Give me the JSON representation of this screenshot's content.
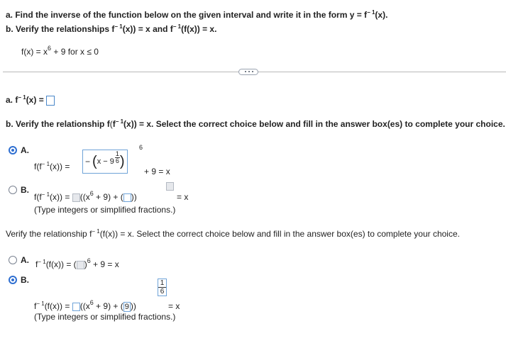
{
  "question": {
    "part_a": "a. Find the inverse of the function below on the given interval and write it in the form y = f",
    "part_a_tail": "(x).",
    "part_b": "b. Verify the relationships f",
    "part_b_mid": "(x)) = x and f",
    "part_b_tail": "(f(x)) = x.",
    "function_lhs": "f(x) = x",
    "function_rhs": " + 9 for x ≤ 0",
    "exp6": "6",
    "inv_sup": "− 1"
  },
  "answer_a": {
    "label": "a. f",
    "label_tail": "(x) ="
  },
  "part_b_section": {
    "prompt_lead": "b. Verify the relationship f",
    "prompt_mid": "(x)) = x. Select the correct choice below and fill in the answer box(es) to complete your choice.",
    "option_a_label": "A.",
    "option_a_lhs": "f(f",
    "option_a_lhs_tail": "(x)) =",
    "option_a_minus": "−",
    "option_a_inner": "x − 9",
    "option_a_frac_num": "1",
    "option_a_frac_den": "6",
    "option_a_outer_exp": "6",
    "option_a_tail": "+ 9 = x",
    "option_b_label": "B.",
    "option_b_lhs": "f(f",
    "option_b_lhs_tail": "(x)) =",
    "option_b_mid": "((x",
    "option_b_mid2": " + 9) + (",
    "option_b_close": "))",
    "option_b_eq": "= x",
    "hint": "(Type integers or simplified fractions.)"
  },
  "part_c_section": {
    "prompt_lead": "Verify the relationship f",
    "prompt_tail": "(f(x)) = x. Select the correct choice below and fill in the answer box(es) to complete your choice.",
    "option_a_label": "A.",
    "option_a_lhs": "f",
    "option_a_lhs_tail": "(f(x)) = (",
    "option_a_close": ")",
    "option_a_exp": "6",
    "option_a_tail": "+ 9 = x",
    "option_b_label": "B.",
    "option_b_lhs": "f",
    "option_b_lhs_tail": "(f(x)) =",
    "option_b_mid": "((x",
    "option_b_mid2": " + 9) + (",
    "option_b_value": "9",
    "option_b_close": "))",
    "option_b_frac_num": "1",
    "option_b_frac_den": "6",
    "option_b_eq": "= x",
    "hint": "(Type integers or simplified fractions.)"
  },
  "selection": {
    "part_b": "A",
    "part_c": "B"
  },
  "colors": {
    "accent": "#2f6fd1",
    "box_border": "#6fa3d8",
    "divider": "#b8b8b8"
  }
}
